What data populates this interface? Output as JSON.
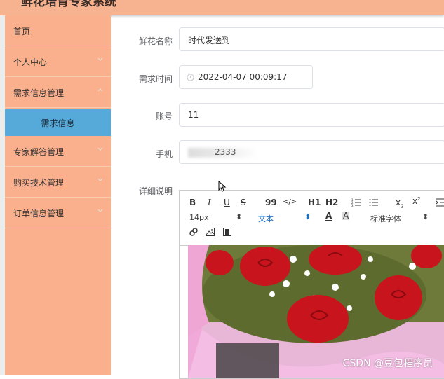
{
  "app": {
    "title": "鲜花培育专家系统"
  },
  "sidebar": {
    "items": [
      {
        "label": "首页",
        "has_chevron": false
      },
      {
        "label": "个人中心",
        "has_chevron": true
      },
      {
        "label": "需求信息管理",
        "has_chevron": true
      },
      {
        "label": "需求信息",
        "active": true
      },
      {
        "label": "专家解答管理",
        "has_chevron": true
      },
      {
        "label": "购买技术管理",
        "has_chevron": true
      },
      {
        "label": "订单信息管理",
        "has_chevron": true
      }
    ],
    "colors": {
      "background": "#fbb08d",
      "active": "#55aad9"
    }
  },
  "form": {
    "flower_name": {
      "label": "鲜花名称",
      "value": "时代发送到"
    },
    "demand_time": {
      "label": "需求时间",
      "value": "2022-04-07 00:09:17",
      "icon": "clock-icon"
    },
    "account": {
      "label": "账号",
      "value": "11"
    },
    "phone": {
      "label": "手机",
      "value": "2333"
    },
    "detail": {
      "label": "详细说明"
    }
  },
  "editor": {
    "toolbar_row1": [
      "B",
      "I",
      "U",
      "S",
      "99",
      "</>",
      "H1",
      "H2",
      "list-ordered-icon",
      "list-bullet-icon",
      "x2-sub",
      "x2-sup",
      "indent-icon"
    ],
    "font_size": "14px",
    "text_style": "文本",
    "font_family": "标准字体",
    "toolbar_row3": [
      "link-icon",
      "image-icon",
      "video-icon"
    ]
  },
  "watermark": "CSDN @豆包程序员",
  "colors": {
    "header": "#f7b28f",
    "accent": "#55aad9"
  }
}
